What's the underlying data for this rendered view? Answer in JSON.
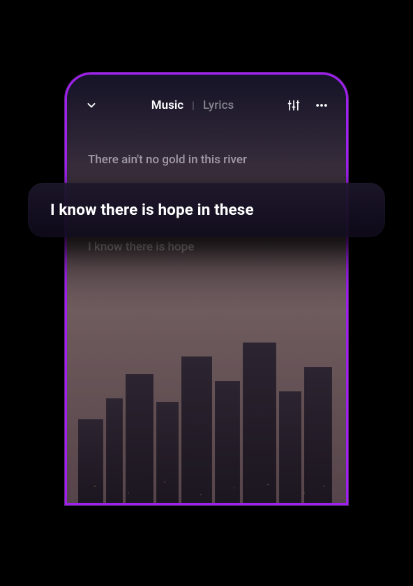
{
  "header": {
    "tab_active": "Music",
    "tab_inactive": "Lyrics",
    "separator": "|"
  },
  "lyrics": {
    "before": "There ain't no gold in this river",
    "current": "I know there is hope in these",
    "after": "I know there is hope"
  }
}
